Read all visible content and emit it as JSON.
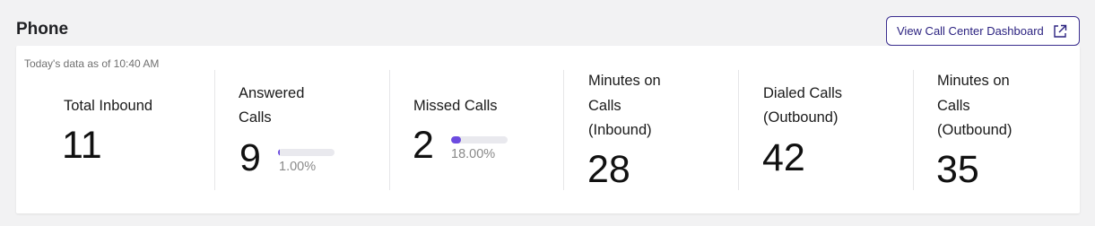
{
  "section": {
    "title": "Phone"
  },
  "dashboard_button": {
    "label": "View Call Center Dashboard",
    "icon": "external-link-icon"
  },
  "as_of": "Today's data as of 10:40 AM",
  "colors": {
    "accent": "#6c4be0",
    "button_border": "#3b2e8f",
    "track": "#e9e9ee"
  },
  "stats": [
    {
      "label_lines": [
        "Total Inbound"
      ],
      "value": "11"
    },
    {
      "label_lines": [
        "Answered",
        "Calls"
      ],
      "value": "9",
      "percent": "1.00%",
      "fraction": 0.01
    },
    {
      "label_lines": [
        "Missed Calls"
      ],
      "value": "2",
      "percent": "18.00%",
      "fraction": 0.18
    },
    {
      "label_lines": [
        "Minutes on",
        "Calls",
        "(Inbound)"
      ],
      "value": "28"
    },
    {
      "label_lines": [
        "Dialed Calls",
        "(Outbound)"
      ],
      "value": "42"
    },
    {
      "label_lines": [
        "Minutes on",
        "Calls",
        "(Outbound)"
      ],
      "value": "35"
    }
  ]
}
